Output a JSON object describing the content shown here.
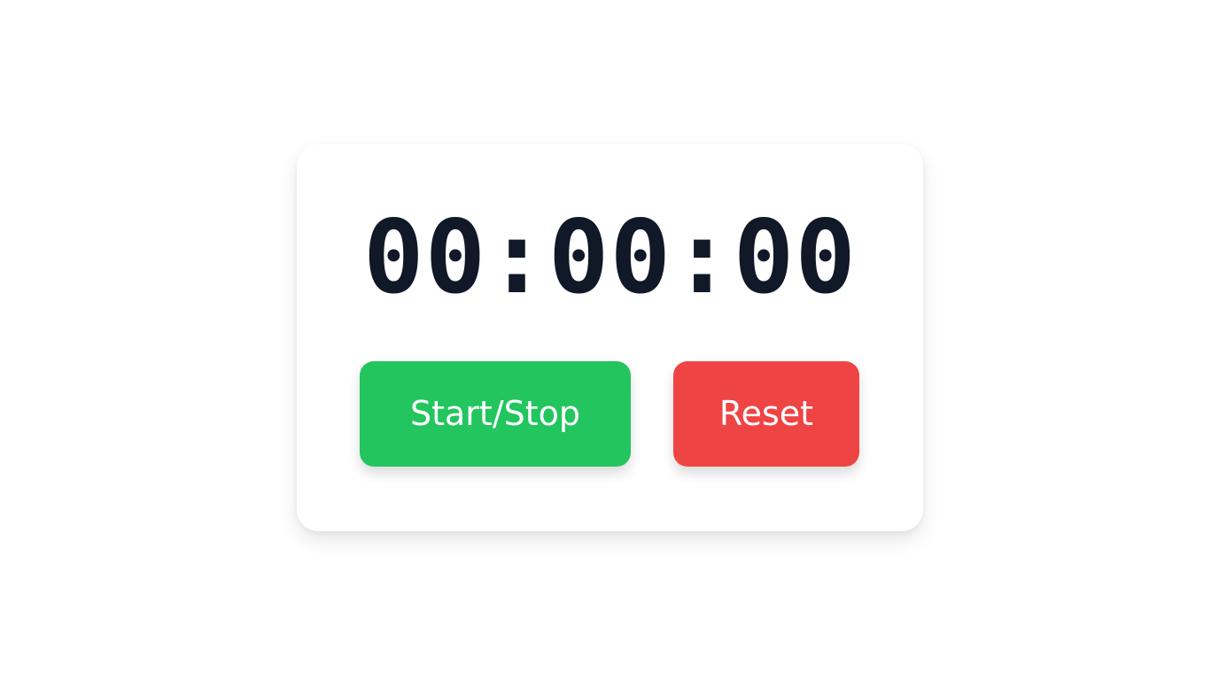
{
  "stopwatch": {
    "time_display": "00:00:00",
    "start_stop_label": "Start/Stop",
    "reset_label": "Reset"
  },
  "colors": {
    "text": "#111827",
    "start_button": "#22c55e",
    "reset_button": "#ef4444",
    "background": "#ffffff"
  }
}
